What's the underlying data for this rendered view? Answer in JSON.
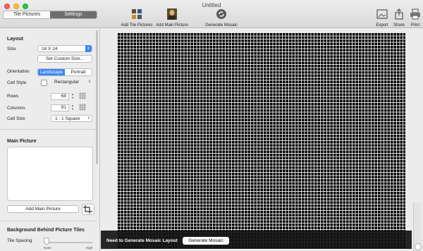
{
  "window": {
    "title": "Untitled"
  },
  "tabs": [
    {
      "label": "Tile Pictures",
      "active": false
    },
    {
      "label": "Settings",
      "active": true
    }
  ],
  "toolbar": {
    "add_tile_pictures": "Add Tile Pictures",
    "add_main_picture": "Add Main Picture",
    "generate_mosaic": "Generate Mosaic",
    "export": "Export",
    "share": "Share",
    "print": "Print"
  },
  "layout": {
    "section_title": "Layout",
    "size_label": "Size",
    "size_value": "18 X 24",
    "custom_size_button": "Set Custom Size...",
    "orientation_label": "Orientation",
    "orientation_options": [
      "Landscape",
      "Portrait"
    ],
    "orientation_selected": "Landscape",
    "cell_style_label": "Cell Style",
    "cell_style_value": "Rectangular",
    "rows_label": "Rows",
    "rows_value": "68",
    "columns_label": "Columns",
    "columns_value": "91",
    "cell_size_label": "Cell Size",
    "cell_size_value": "1 : 1 Square"
  },
  "main_picture": {
    "section_title": "Main Picture",
    "add_button": "Add Main Picture"
  },
  "background": {
    "section_title": "Background Behind Picture Tiles",
    "tile_spacing_label": "Tile Spacing",
    "tile_spacing_min": "None",
    "tile_spacing_max": "High"
  },
  "notice": {
    "text": "Need to Generate Mosaic Layout",
    "button": "Generate Mosaic"
  },
  "colors": {
    "accent": "#3d88f6",
    "mosaic_bg": "#000000"
  }
}
